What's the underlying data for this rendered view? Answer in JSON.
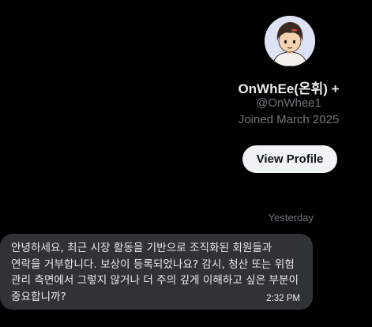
{
  "profile": {
    "display_name": "OnWhEe(온휘) +",
    "handle": "@OnWhee1",
    "joined": "Joined March 2025",
    "view_profile_label": "View Profile"
  },
  "conversation": {
    "day_separator": "Yesterday",
    "messages": [
      {
        "text": "안녕하세요, 최근 시장 활동을 기반으로 조직화된 회원들과 연락을 거부합니다. 보상이 등록되었나요? 감시, 청산 또는 위험 관리 측면에서 그렇지 않거나 더 주의 깊게 이해하고 싶은 부분이 중요합니까?",
        "time": "2:32 PM"
      }
    ]
  },
  "colors": {
    "background": "#000000",
    "bubble": "#2f3336",
    "text": "#e7e9ea",
    "muted": "#71767b",
    "button_bg": "#eff3f4"
  },
  "icons": {
    "avatar": "cartoon-avatar"
  }
}
